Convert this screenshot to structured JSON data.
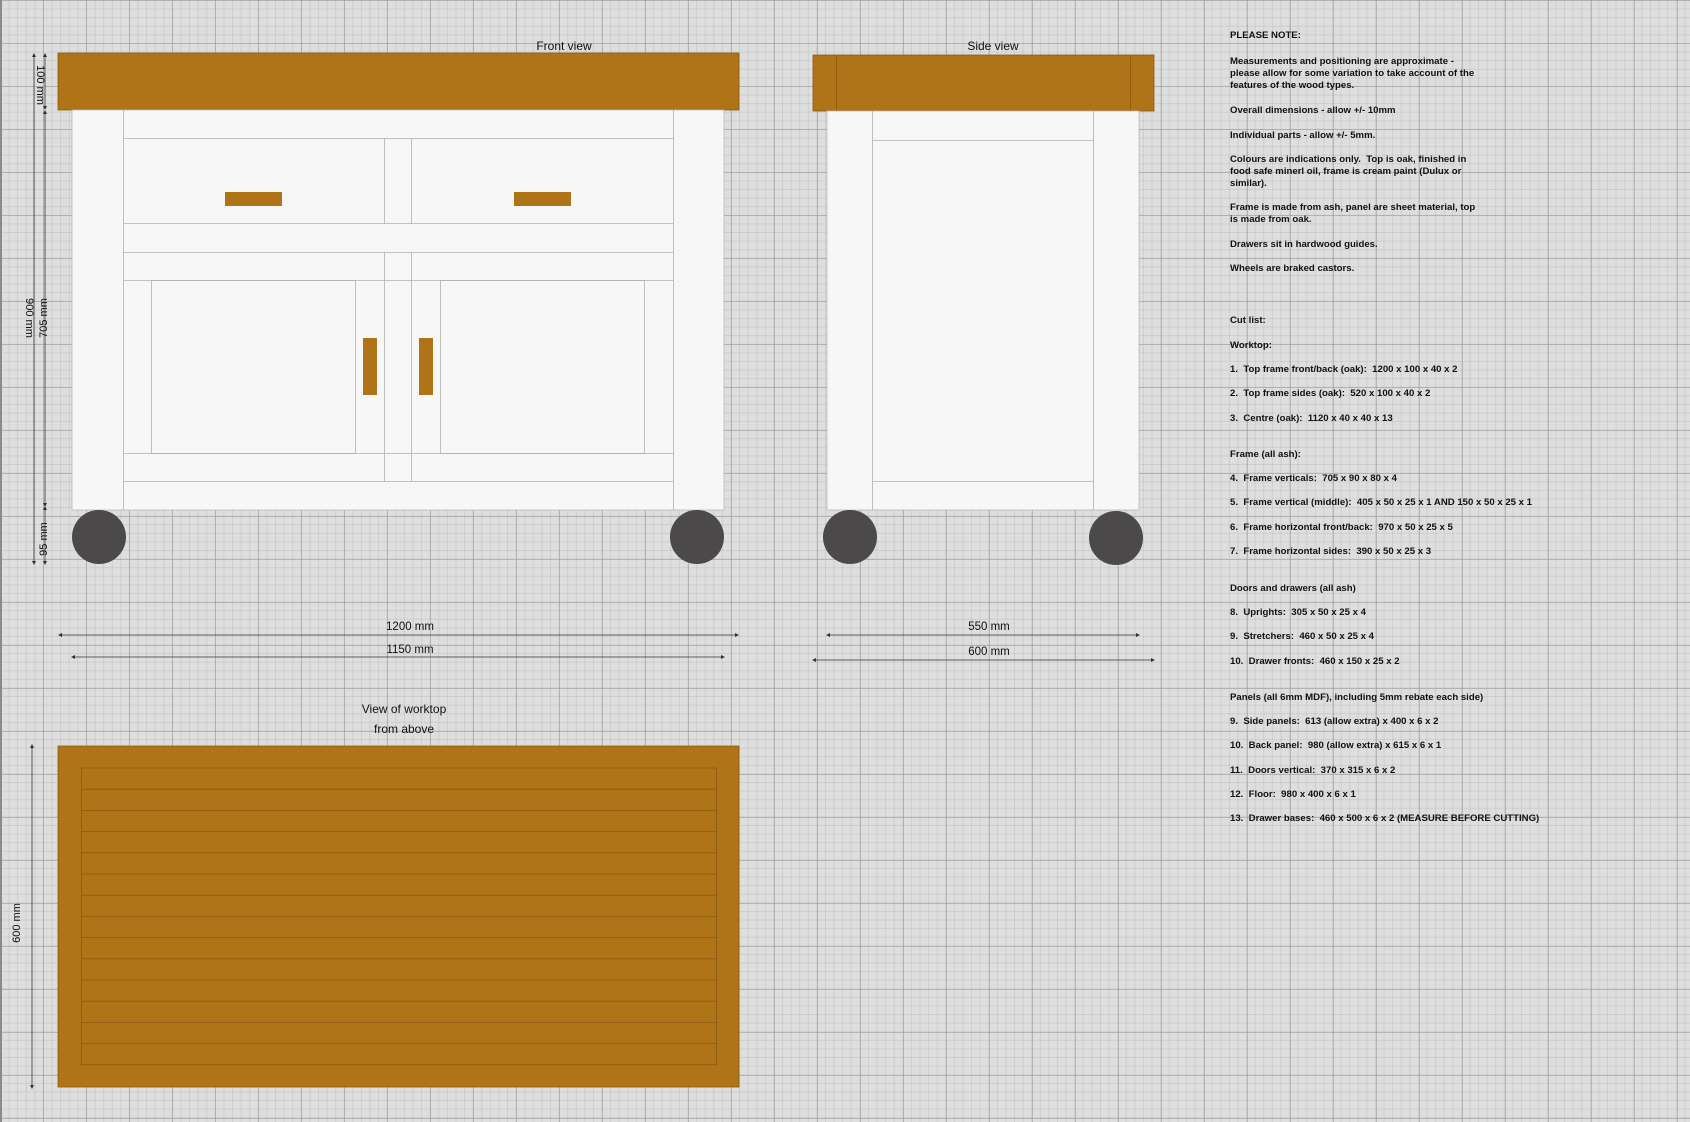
{
  "views": {
    "front_title": "Front view",
    "side_title": "Side view",
    "top_title_1": "View of worktop",
    "top_title_2": "from above"
  },
  "dimensions": {
    "front_top_height": "100 mm",
    "front_frame_height": "705 mm",
    "front_total_height": "900 mm",
    "front_wheel_height": "95 mm",
    "front_top_width": "1200 mm",
    "front_frame_width": "1150 mm",
    "side_frame_width": "550 mm",
    "side_top_width": "600 mm",
    "worktop_depth": "600 mm"
  },
  "colors": {
    "oak": "#b07418",
    "cream": "#f7f7f7",
    "wheel": "#4b4949"
  },
  "notes": [
    "PLEASE NOTE:",
    "Measurements and positioning are approximate -",
    "please allow for some variation to take account of the",
    "features of the wood types.",
    "Overall dimensions - allow +/- 10mm",
    "Individual parts - allow +/- 5mm.",
    "Colours are indications only.  Top is oak, finished in",
    "food safe minerl oil, frame is cream paint (Dulux or",
    "similar).",
    "Frame is made from ash, panel are sheet material, top",
    "is made from oak.",
    "Drawers sit in hardwood guides.",
    "Wheels are braked castors.",
    "Cut list:",
    "Worktop:",
    "1.  Top frame front/back (oak):  1200 x 100 x 40 x 2",
    "2.  Top frame sides (oak):  520 x 100 x 40 x 2",
    "3.  Centre (oak):  1120 x 40 x 40 x 13",
    "Frame (all ash):",
    "4.  Frame verticals:  705 x 90 x 80 x 4",
    "5.  Frame vertical (middle):  405 x 50 x 25 x 1 AND 150 x 50 x 25 x 1",
    "6.  Frame horizontal front/back:  970 x 50 x 25 x 5",
    "7.  Frame horizontal sides:  390 x 50 x 25 x 3",
    "Doors and drawers (all ash)",
    "8.  Uprights:  305 x 50 x 25 x 4",
    "9.  Stretchers:  460 x 50 x 25 x 4",
    "10.  Drawer fronts:  460 x 150 x 25 x 2",
    "Panels (all 6mm MDF), including 5mm rebate each side)",
    "9.  Side panels:  613 (allow extra) x 400 x 6 x 2",
    "10.  Back panel:  980 (allow extra) x 615 x 6 x 1",
    "11.  Doors vertical:  370 x 315 x 6 x 2",
    "12.  Floor:  980 x 400 x 6 x 1",
    "13.  Drawer bases:  460 x 500 x 6 x 2 (MEASURE BEFORE CUTTING)"
  ]
}
